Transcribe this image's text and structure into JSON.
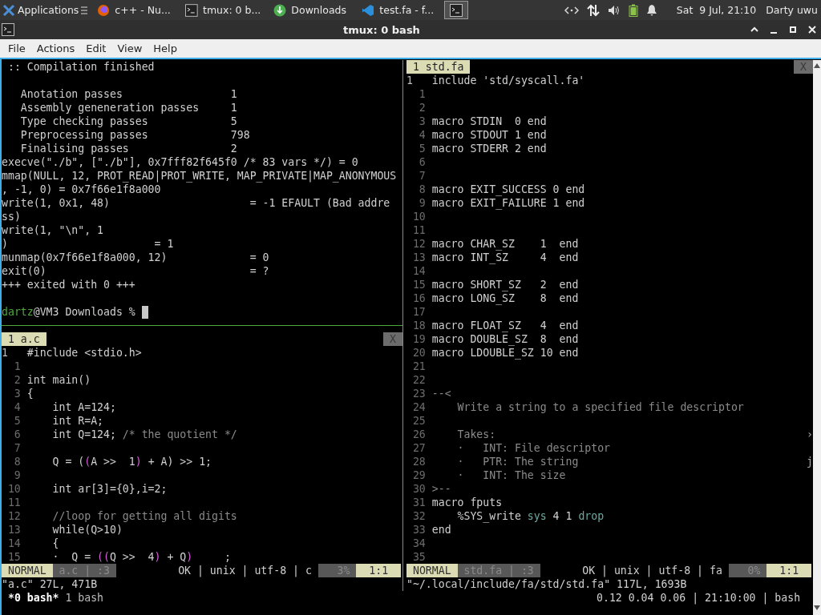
{
  "taskbar": {
    "start": {
      "label": "Applications"
    },
    "tasks": [
      {
        "label": "c++ - Nu...",
        "kind": "browser",
        "selected": false
      },
      {
        "label": "tmux: 0 b...",
        "kind": "terminal",
        "selected": false
      },
      {
        "label": "Downloads",
        "kind": "download",
        "selected": false
      },
      {
        "label": "test.fa - f...",
        "kind": "editor",
        "selected": false
      },
      {
        "kind": "terminal",
        "selected": true
      }
    ],
    "clock": "Sat  9 Jul, 21:10",
    "user": "Darty uwu"
  },
  "window": {
    "title": "tmux: 0 bash"
  },
  "menu": [
    "File",
    "Actions",
    "Edit",
    "View",
    "Help"
  ],
  "shell": {
    "heading": ":: Compilation finished",
    "stats": [
      {
        "label": "Anotation passes",
        "value": "1"
      },
      {
        "label": "Assembly geneneration passes",
        "value": "1"
      },
      {
        "label": "Type checking passes",
        "value": "5"
      },
      {
        "label": "Preprocessing passes",
        "value": "798"
      },
      {
        "label": "Finalising passes",
        "value": "2"
      }
    ],
    "output": [
      "execve(\"./b\", [\"./b\"], 0x7fff82f645f0 /* 83 vars */) = 0",
      "mmap(NULL, 12, PROT_READ|PROT_WRITE, MAP_PRIVATE|MAP_ANONYMOUS",
      ", -1, 0) = 0x7f66e1f8a000",
      "write(1, 0x1, 48)                      = -1 EFAULT (Bad addre",
      "ss)",
      "write(1, \"\\n\", 1",
      ")                       = 1",
      "munmap(0x7f66e1f8a000, 12)             = 0",
      "exit(0)                                = ?",
      "+++ exited with 0 +++"
    ],
    "prompt": {
      "user": "dartz",
      "rest": "@VM3 Downloads %"
    }
  },
  "editors": [
    {
      "tab": "1 a.c",
      "close": "X",
      "cursor_line": {
        "number": "1",
        "text": "#include <stdio.h>"
      },
      "lines": [
        {
          "number": "1"
        },
        {
          "number": "2",
          "text": "int main()"
        },
        {
          "number": "3",
          "text": "{"
        },
        {
          "number": "4",
          "text": "    int A=124;"
        },
        {
          "number": "5",
          "text": "    int R=A;"
        },
        {
          "number": "6",
          "spans": [
            {
              "text": "    int Q=124; ",
              "kind": "code"
            },
            {
              "text": "/* the quotient */",
              "kind": "comment"
            }
          ]
        },
        {
          "number": "7"
        },
        {
          "number": "8",
          "spans": [
            {
              "text": "    Q = (",
              "kind": "code"
            },
            {
              "text": "(",
              "kind": "paren"
            },
            {
              "text": "A >>  1",
              "kind": "code"
            },
            {
              "text": ")",
              "kind": "paren"
            },
            {
              "text": " + A) >> 1;",
              "kind": "code"
            }
          ]
        },
        {
          "number": "9"
        },
        {
          "number": "10",
          "text": "    int ar[3]={0},i=2;"
        },
        {
          "number": "11"
        },
        {
          "number": "12",
          "text": "    //loop for getting all digits",
          "kind": "comment"
        },
        {
          "number": "13",
          "text": "    while(Q>10)"
        },
        {
          "number": "14",
          "text": "    {"
        },
        {
          "number": "15",
          "spans": [
            {
              "text": "    ·  Q = ",
              "kind": "code"
            },
            {
              "text": "((",
              "kind": "paren"
            },
            {
              "text": "Q >>  4",
              "kind": "code"
            },
            {
              "text": ")",
              "kind": "paren"
            },
            {
              "text": " + Q",
              "kind": "code"
            },
            {
              "text": ")",
              "kind": "paren"
            },
            {
              "text": "     ;",
              "kind": "code"
            }
          ]
        }
      ],
      "status": {
        "mode": "NORMAL",
        "file": "a.c | :3",
        "info": "OK | unix | utf-8 | c",
        "percent": "3%",
        "position": "1:1"
      },
      "message": "\"a.c\" 27L, 471B"
    },
    {
      "tab": "1 std.fa",
      "close": "X",
      "cursor_line": {
        "number": "1",
        "text": "include 'std/syscall.fa'"
      },
      "lines": [
        {
          "number": "1"
        },
        {
          "number": "2"
        },
        {
          "number": "3",
          "text": "macro STDIN  0 end"
        },
        {
          "number": "4",
          "text": "macro STDOUT 1 end"
        },
        {
          "number": "5",
          "text": "macro STDERR 2 end"
        },
        {
          "number": "6"
        },
        {
          "number": "7"
        },
        {
          "number": "8",
          "text": "macro EXIT_SUCCESS 0 end"
        },
        {
          "number": "9",
          "text": "macro EXIT_FAILURE 1 end"
        },
        {
          "number": "10"
        },
        {
          "number": "11"
        },
        {
          "number": "12",
          "text": "macro CHAR_SZ    1  end"
        },
        {
          "number": "13",
          "text": "macro INT_SZ     4  end"
        },
        {
          "number": "14"
        },
        {
          "number": "15",
          "text": "macro SHORT_SZ   2  end"
        },
        {
          "number": "16",
          "text": "macro LONG_SZ    8  end"
        },
        {
          "number": "17"
        },
        {
          "number": "18",
          "text": "macro FLOAT_SZ   4  end"
        },
        {
          "number": "19",
          "text": "macro DOUBLE_SZ  8  end"
        },
        {
          "number": "20",
          "text": "macro LDOUBLE_SZ 10 end"
        },
        {
          "number": "21"
        },
        {
          "number": "22"
        },
        {
          "number": "23",
          "text": "--<",
          "kind": "comment"
        },
        {
          "number": "24",
          "text": "    Write a string to a specified file descriptor",
          "kind": "comment"
        },
        {
          "number": "25"
        },
        {
          "number": "26",
          "text": "    Takes:",
          "kind": "comment",
          "edge": "›"
        },
        {
          "number": "27",
          "text": "    ·   INT: File descriptor",
          "kind": "comment"
        },
        {
          "number": "28",
          "text": "    ·   PTR: The string",
          "kind": "comment",
          "edge": "j"
        },
        {
          "number": "29",
          "text": "    ·   INT: The size",
          "kind": "comment"
        },
        {
          "number": "30",
          "text": ">--",
          "kind": "comment"
        },
        {
          "number": "31",
          "text": "macro fputs"
        },
        {
          "number": "32",
          "spans": [
            {
              "text": "    %SYS_write ",
              "kind": "code"
            },
            {
              "text": "sys",
              "kind": "builtin"
            },
            {
              "text": " 4 1 ",
              "kind": "code"
            },
            {
              "text": "drop",
              "kind": "builtin"
            }
          ]
        },
        {
          "number": "33",
          "text": "end"
        },
        {
          "number": "34"
        },
        {
          "number": "35"
        }
      ],
      "status": {
        "mode": "NORMAL",
        "file": "std.fa | :3",
        "info": "OK | unix | utf-8 | fa",
        "percent": "0%",
        "position": "1:1"
      },
      "message": "\"~/.local/include/fa/std/std.fa\" 117L, 1693B"
    }
  ],
  "tmux": {
    "windows": [
      {
        "label": "*0 bash*",
        "selected": true
      },
      {
        "label": "1 bash",
        "selected": false
      }
    ],
    "right": "0.12 0.04 0.06 | 21:10:00 | bash"
  }
}
